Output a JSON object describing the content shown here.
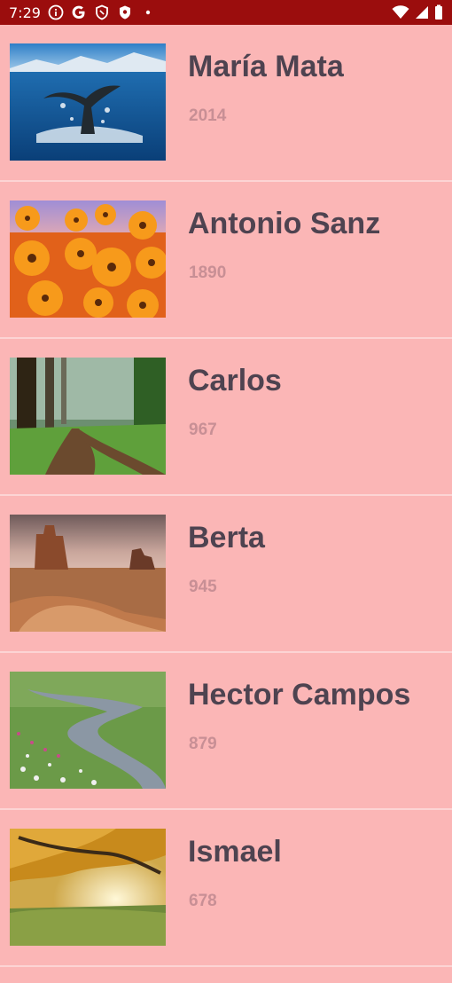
{
  "status_bar": {
    "time": "7:29",
    "icons_left": [
      "info-icon",
      "google-icon",
      "shield-icon",
      "shield-filled-icon",
      "dot-icon"
    ],
    "icons_right": [
      "wifi-icon",
      "signal-icon",
      "battery-icon"
    ]
  },
  "items": [
    {
      "name": "María Mata",
      "year": "2014",
      "image": "whale-tail-ocean"
    },
    {
      "name": "Antonio Sanz",
      "year": "1890",
      "image": "orange-flowers"
    },
    {
      "name": "Carlos",
      "year": "967",
      "image": "forest-path"
    },
    {
      "name": "Berta",
      "year": "945",
      "image": "desert-monument-valley"
    },
    {
      "name": "Hector Campos",
      "year": "879",
      "image": "mountain-stream-meadow"
    },
    {
      "name": "Ismael",
      "year": "678",
      "image": "autumn-tree-sunset"
    }
  ]
}
